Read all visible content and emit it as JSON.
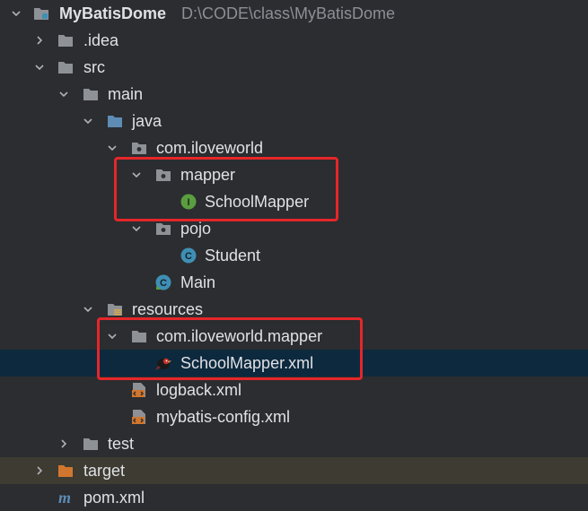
{
  "tree": {
    "root": {
      "label": "MyBatisDome",
      "path": "D:\\CODE\\class\\MyBatisDome"
    },
    "idea": {
      "label": ".idea"
    },
    "src": {
      "label": "src"
    },
    "main": {
      "label": "main"
    },
    "java": {
      "label": "java"
    },
    "pkg": {
      "label": "com.iloveworld"
    },
    "mapper": {
      "label": "mapper"
    },
    "school_mapper": {
      "label": "SchoolMapper",
      "badge": "I"
    },
    "pojo": {
      "label": "pojo"
    },
    "student": {
      "label": "Student",
      "badge": "C"
    },
    "main_class": {
      "label": "Main",
      "badge": "C"
    },
    "resources": {
      "label": "resources"
    },
    "res_pkg": {
      "label": "com.iloveworld.mapper"
    },
    "school_mapper_xml": {
      "label": "SchoolMapper.xml"
    },
    "logback": {
      "label": "logback.xml"
    },
    "mybatis_config": {
      "label": "mybatis-config.xml"
    },
    "test": {
      "label": "test"
    },
    "target": {
      "label": "target"
    },
    "pom": {
      "label": "pom.xml",
      "badge": "m"
    }
  },
  "colors": {
    "background": "#2b2d30",
    "selected_row": "#0d293e",
    "excluded_row": "#3d3b32",
    "highlight": "#e5262a",
    "text": "#dfe1e5",
    "path_text": "#8c8f94",
    "folder": "#8e9196",
    "source_folder": "#5e8cb5",
    "excluded_folder": "#d1762e",
    "interface_badge": "#5a9e3f",
    "class_badge": "#3f8fb4"
  },
  "state": {
    "selected": "school_mapper_xml",
    "highlighted": [
      "mapper",
      "school_mapper",
      "res_pkg",
      "school_mapper_xml"
    ]
  }
}
